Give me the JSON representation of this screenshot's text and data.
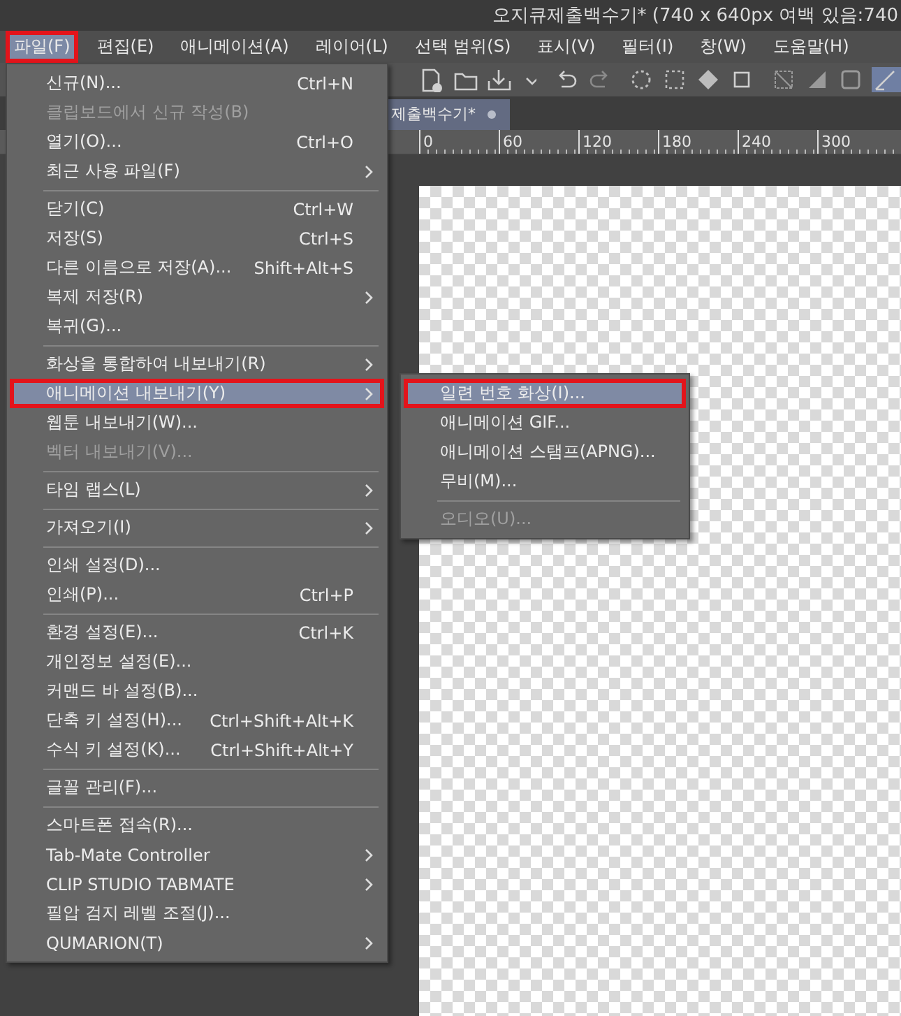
{
  "window": {
    "title": "오지큐제출백수기* (740 x 640px 여백 있음:740"
  },
  "menubar": [
    {
      "label": "파일(F)",
      "selected": true,
      "annotated": true
    },
    {
      "label": "편집(E)",
      "selected": false,
      "annotated": false
    },
    {
      "label": "애니메이션(A)",
      "selected": false,
      "annotated": false
    },
    {
      "label": "레이어(L)",
      "selected": false,
      "annotated": false
    },
    {
      "label": "선택 범위(S)",
      "selected": false,
      "annotated": false
    },
    {
      "label": "표시(V)",
      "selected": false,
      "annotated": false
    },
    {
      "label": "필터(I)",
      "selected": false,
      "annotated": false
    },
    {
      "label": "창(W)",
      "selected": false,
      "annotated": false
    },
    {
      "label": "도움말(H)",
      "selected": false,
      "annotated": false
    }
  ],
  "document_tab": {
    "label": "제출백수기*"
  },
  "ruler": {
    "ticks": [
      "0",
      "60",
      "120",
      "180",
      "240",
      "300"
    ]
  },
  "file_menu": {
    "items": [
      {
        "kind": "item",
        "label": "신규(N)...",
        "shortcut": "Ctrl+N",
        "submenu": false,
        "disabled": false,
        "selected": false,
        "annotated": false
      },
      {
        "kind": "item",
        "label": "클립보드에서 신규 작성(B)",
        "submenu": false,
        "disabled": true,
        "selected": false,
        "annotated": false
      },
      {
        "kind": "item",
        "label": "열기(O)...",
        "shortcut": "Ctrl+O",
        "submenu": false,
        "disabled": false,
        "selected": false,
        "annotated": false
      },
      {
        "kind": "item",
        "label": "최근 사용 파일(F)",
        "submenu": true,
        "disabled": false,
        "selected": false,
        "annotated": false
      },
      {
        "kind": "separator"
      },
      {
        "kind": "item",
        "label": "닫기(C)",
        "shortcut": "Ctrl+W",
        "submenu": false,
        "disabled": false,
        "selected": false,
        "annotated": false
      },
      {
        "kind": "item",
        "label": "저장(S)",
        "shortcut": "Ctrl+S",
        "submenu": false,
        "disabled": false,
        "selected": false,
        "annotated": false
      },
      {
        "kind": "item",
        "label": "다른 이름으로 저장(A)...",
        "shortcut": "Shift+Alt+S",
        "submenu": false,
        "disabled": false,
        "selected": false,
        "annotated": false
      },
      {
        "kind": "item",
        "label": "복제 저장(R)",
        "submenu": true,
        "disabled": false,
        "selected": false,
        "annotated": false
      },
      {
        "kind": "item",
        "label": "복귀(G)...",
        "submenu": false,
        "disabled": false,
        "selected": false,
        "annotated": false
      },
      {
        "kind": "separator"
      },
      {
        "kind": "item",
        "label": "화상을 통합하여 내보내기(R)",
        "submenu": true,
        "disabled": false,
        "selected": false,
        "annotated": false
      },
      {
        "kind": "item",
        "label": "애니메이션 내보내기(Y)",
        "submenu": true,
        "disabled": false,
        "selected": true,
        "annotated": true
      },
      {
        "kind": "item",
        "label": "웹툰 내보내기(W)...",
        "submenu": false,
        "disabled": false,
        "selected": false,
        "annotated": false
      },
      {
        "kind": "item",
        "label": "벡터 내보내기(V)...",
        "submenu": false,
        "disabled": true,
        "selected": false,
        "annotated": false
      },
      {
        "kind": "separator"
      },
      {
        "kind": "item",
        "label": "타임 랩스(L)",
        "submenu": true,
        "disabled": false,
        "selected": false,
        "annotated": false
      },
      {
        "kind": "separator"
      },
      {
        "kind": "item",
        "label": "가져오기(I)",
        "submenu": true,
        "disabled": false,
        "selected": false,
        "annotated": false
      },
      {
        "kind": "separator"
      },
      {
        "kind": "item",
        "label": "인쇄 설정(D)...",
        "submenu": false,
        "disabled": false,
        "selected": false,
        "annotated": false
      },
      {
        "kind": "item",
        "label": "인쇄(P)...",
        "shortcut": "Ctrl+P",
        "submenu": false,
        "disabled": false,
        "selected": false,
        "annotated": false
      },
      {
        "kind": "separator"
      },
      {
        "kind": "item",
        "label": "환경 설정(E)...",
        "shortcut": "Ctrl+K",
        "submenu": false,
        "disabled": false,
        "selected": false,
        "annotated": false
      },
      {
        "kind": "item",
        "label": "개인정보 설정(E)...",
        "submenu": false,
        "disabled": false,
        "selected": false,
        "annotated": false
      },
      {
        "kind": "item",
        "label": "커맨드 바 설정(B)...",
        "submenu": false,
        "disabled": false,
        "selected": false,
        "annotated": false
      },
      {
        "kind": "item",
        "label": "단축 키 설정(H)...",
        "shortcut": "Ctrl+Shift+Alt+K",
        "submenu": false,
        "disabled": false,
        "selected": false,
        "annotated": false
      },
      {
        "kind": "item",
        "label": "수식 키 설정(K)...",
        "shortcut": "Ctrl+Shift+Alt+Y",
        "submenu": false,
        "disabled": false,
        "selected": false,
        "annotated": false
      },
      {
        "kind": "separator"
      },
      {
        "kind": "item",
        "label": "글꼴 관리(F)...",
        "submenu": false,
        "disabled": false,
        "selected": false,
        "annotated": false
      },
      {
        "kind": "separator"
      },
      {
        "kind": "item",
        "label": "스마트폰 접속(R)...",
        "submenu": false,
        "disabled": false,
        "selected": false,
        "annotated": false
      },
      {
        "kind": "item",
        "label": "Tab-Mate Controller",
        "submenu": true,
        "disabled": false,
        "selected": false,
        "annotated": false
      },
      {
        "kind": "item",
        "label": "CLIP STUDIO TABMATE",
        "submenu": true,
        "disabled": false,
        "selected": false,
        "annotated": false
      },
      {
        "kind": "item",
        "label": "필압 검지 레벨 조절(J)...",
        "submenu": false,
        "disabled": false,
        "selected": false,
        "annotated": false
      },
      {
        "kind": "item",
        "label": "QUMARION(T)",
        "submenu": true,
        "disabled": false,
        "selected": false,
        "annotated": false
      }
    ]
  },
  "animation_submenu": {
    "items": [
      {
        "kind": "item",
        "label": "일련 번호 화상(I)...",
        "disabled": false,
        "selected": true,
        "annotated": true
      },
      {
        "kind": "item",
        "label": "애니메이션 GIF...",
        "disabled": false,
        "selected": false,
        "annotated": false
      },
      {
        "kind": "item",
        "label": "애니메이션 스탬프(APNG)...",
        "disabled": false,
        "selected": false,
        "annotated": false
      },
      {
        "kind": "item",
        "label": "무비(M)...",
        "disabled": false,
        "selected": false,
        "annotated": false
      },
      {
        "kind": "separator"
      },
      {
        "kind": "item",
        "label": "오디오(U)...",
        "disabled": true,
        "selected": false,
        "annotated": false
      }
    ]
  }
}
